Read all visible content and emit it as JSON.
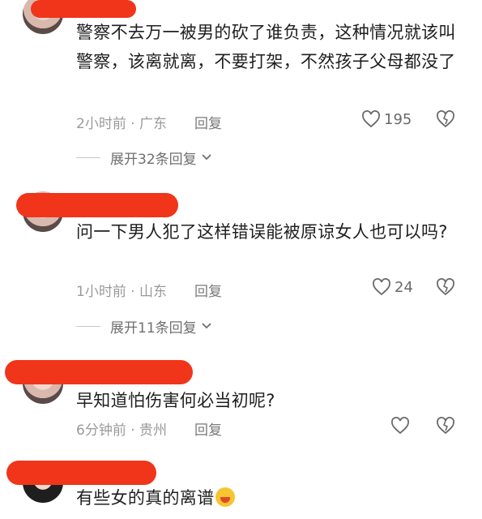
{
  "comments": [
    {
      "text": "警察不去万一被男的砍了谁负责，这种情况就该叫警察，该离就离，不要打架，不然孩子父母都没了",
      "time": "2小时前 · 广东",
      "reply": "回复",
      "likes": "195",
      "expand": "展开32条回复"
    },
    {
      "text": "问一下男人犯了这样错误能被原谅女人也可以吗?",
      "time": "1小时前 · 山东",
      "reply": "回复",
      "likes": "24",
      "expand": "展开11条回复"
    },
    {
      "text": "早知道怕伤害何必当初呢?",
      "time": "6分钟前 · 贵州",
      "reply": "回复",
      "likes": ""
    },
    {
      "text": "有些女的真的离谱"
    }
  ],
  "icons": {
    "like": "heart-outline-icon",
    "dislike": "broken-heart-icon",
    "expand": "chevron-down-icon",
    "emoji": "laughing-emoji-icon"
  },
  "colors": {
    "redaction": "#f0351b",
    "meta": "#9a9a9a",
    "text": "#1f1f1f"
  }
}
